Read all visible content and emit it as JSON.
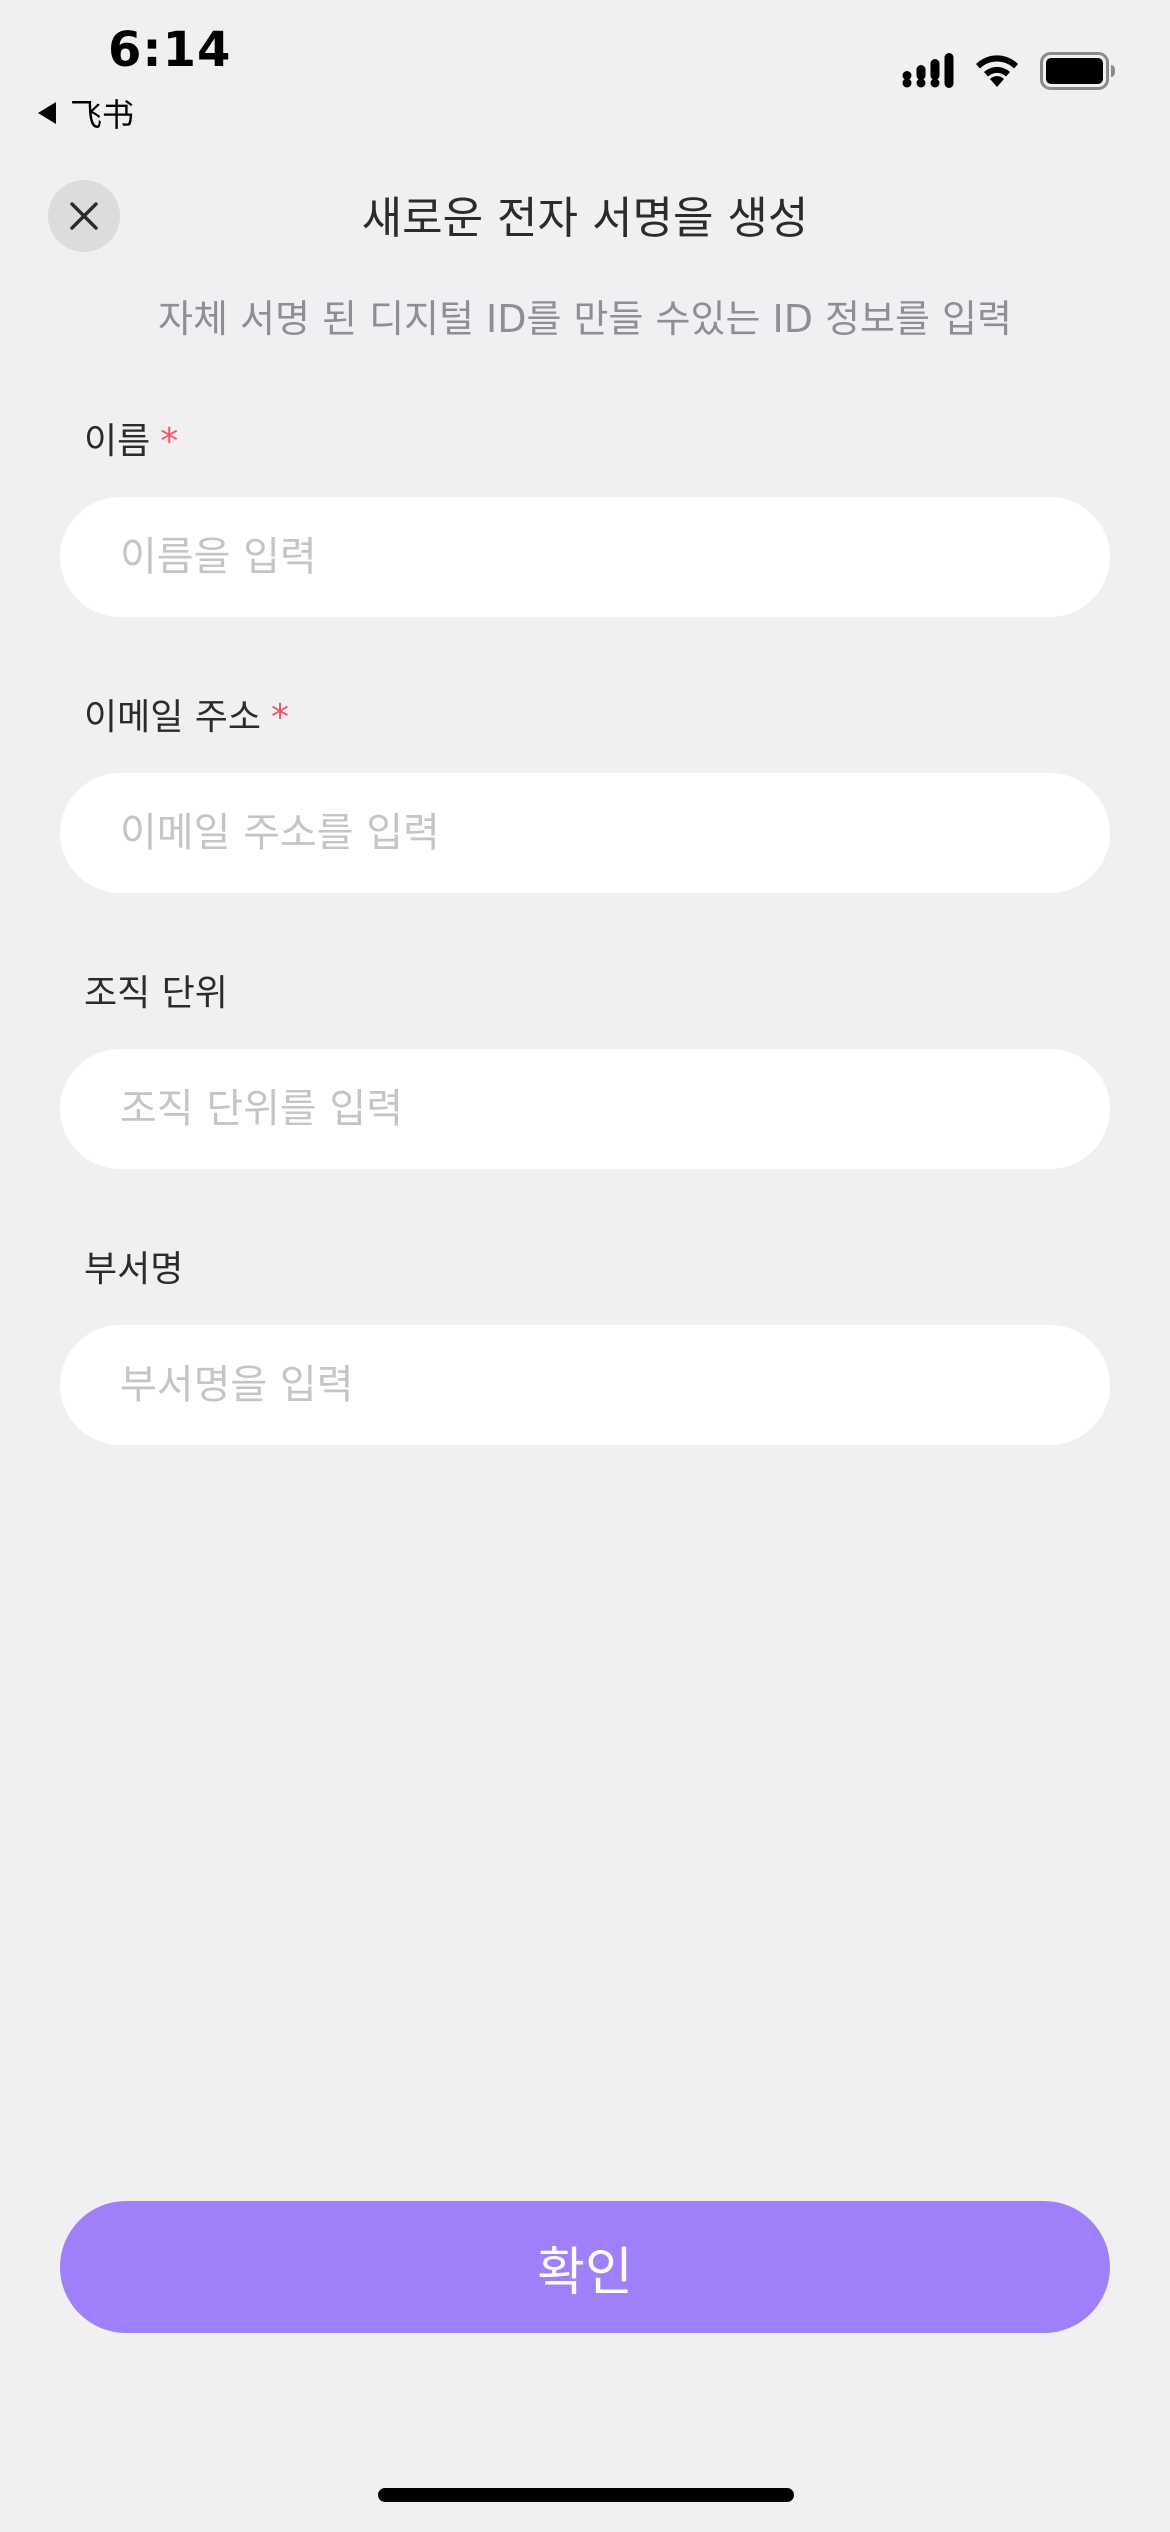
{
  "status_bar": {
    "time": "6:14",
    "back_app": "飞书"
  },
  "header": {
    "title": "새로운 전자 서명을 생성",
    "subtitle": "자체 서명 된 디지털 ID를 만들 수있는 ID 정보를 입력"
  },
  "form": {
    "name": {
      "label": "이름",
      "required_mark": "*",
      "placeholder": "이름을 입력",
      "value": ""
    },
    "email": {
      "label": "이메일 주소",
      "required_mark": "*",
      "placeholder": "이메일 주소를 입력",
      "value": ""
    },
    "org_unit": {
      "label": "조직 단위",
      "placeholder": "조직 단위를 입력",
      "value": ""
    },
    "department": {
      "label": "부서명",
      "placeholder": "부서명을 입력",
      "value": ""
    }
  },
  "confirm_label": "확인",
  "colors": {
    "background": "#f0eff1",
    "accent": "#a07ffa",
    "required": "#f2566a"
  },
  "icons": {
    "close": "close-icon",
    "signal": "cellular-signal-icon",
    "wifi": "wifi-icon",
    "battery": "battery-icon",
    "back": "back-triangle-icon"
  }
}
